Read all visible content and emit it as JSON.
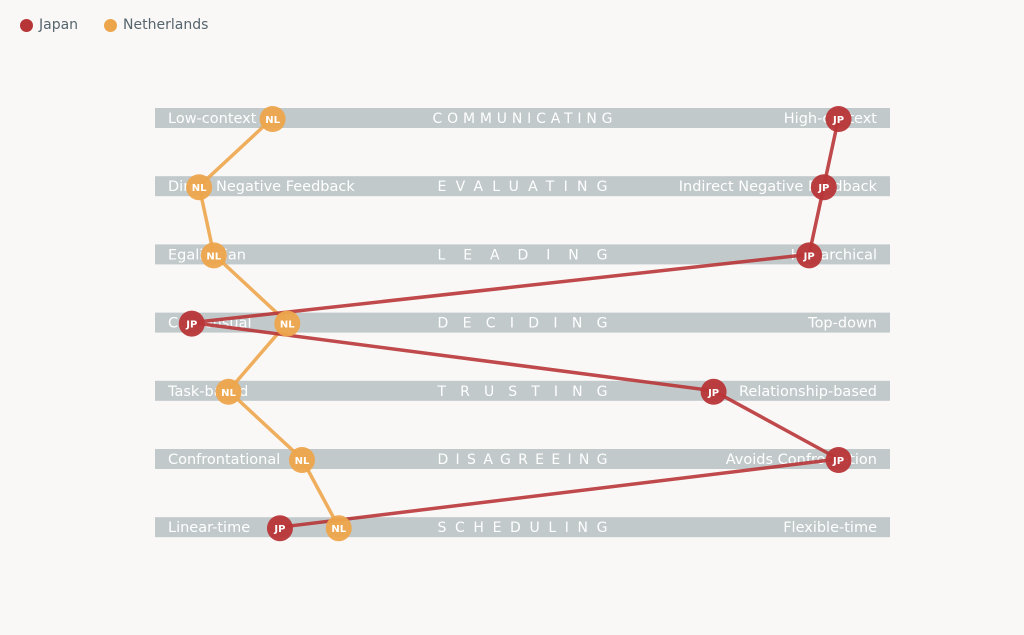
{
  "legend": [
    {
      "name": "Japan",
      "color": "#b83537"
    },
    {
      "name": "Netherlands",
      "color": "#eda54b"
    }
  ],
  "chart_data": {
    "type": "scatter",
    "subtype": "culture-map-dumbbell",
    "scale_range": [
      0,
      1
    ],
    "scales": [
      {
        "category": "COMMUNICATING",
        "left": "Low-context",
        "right": "High-context"
      },
      {
        "category": "EVALUATING",
        "left": "Direct Negative Feedback",
        "right": "Indirect Negative Feedback"
      },
      {
        "category": "LEADING",
        "left": "Egalitarian",
        "right": "Hierarchical"
      },
      {
        "category": "DECIDING",
        "left": "Consensual",
        "right": "Top-down"
      },
      {
        "category": "TRUSTING",
        "left": "Task-based",
        "right": "Relationship-based"
      },
      {
        "category": "DISAGREEING",
        "left": "Confrontational",
        "right": "Avoids Confrontation"
      },
      {
        "category": "SCHEDULING",
        "left": "Linear-time",
        "right": "Flexible-time"
      }
    ],
    "series": [
      {
        "name": "Japan",
        "abbr": "JP",
        "color": "#b83537",
        "values": [
          0.93,
          0.91,
          0.89,
          0.05,
          0.76,
          0.93,
          0.17
        ]
      },
      {
        "name": "Netherlands",
        "abbr": "NL",
        "color": "#eda54b",
        "values": [
          0.16,
          0.06,
          0.08,
          0.18,
          0.1,
          0.2,
          0.25
        ]
      }
    ]
  }
}
